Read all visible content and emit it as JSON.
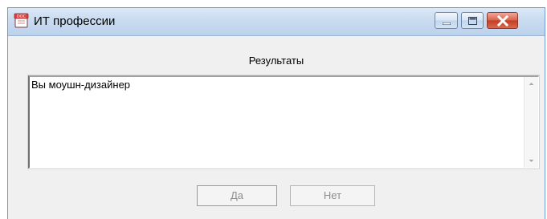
{
  "window": {
    "title": "ИТ профессии",
    "icon": "doc-icon",
    "controls": [
      "minimize-icon",
      "maximize-icon",
      "close-icon"
    ]
  },
  "content": {
    "results_label": "Результаты",
    "memo_text": "Вы моушн-дизайнер"
  },
  "buttons": {
    "yes_label": "Да",
    "no_label": "Нет"
  },
  "colors": {
    "titlebar": "#c9dbf0",
    "close_button": "#c43d23",
    "window_bg": "#f0f0f0",
    "disabled_text": "#8d8d8d"
  }
}
